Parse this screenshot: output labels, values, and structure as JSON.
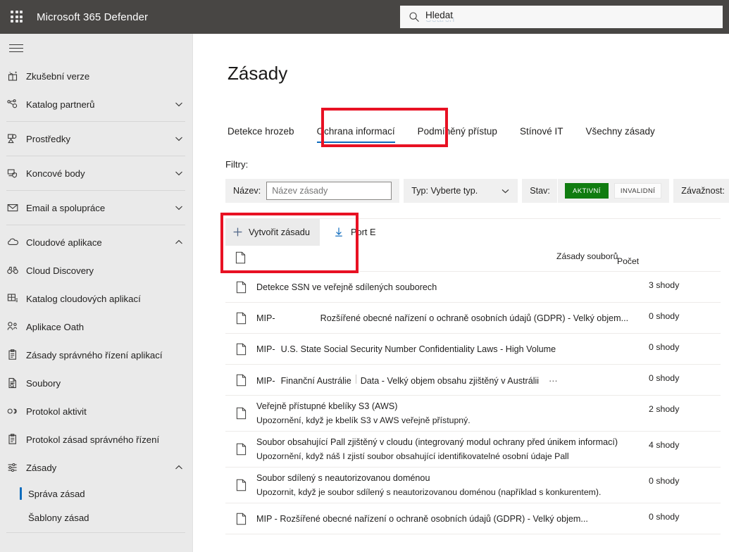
{
  "suite": {
    "waffle_icon": "app-launcher-waffle-icon",
    "title": "Microsoft 365 Defender",
    "search": {
      "icon": "search-icon",
      "placeholder": "Hledat",
      "ghost_text": "Search"
    }
  },
  "nav": {
    "hamburger_label": "global-nav-toggle",
    "groups": [
      {
        "items": [
          {
            "label": "Zkušební verze",
            "icon": "gift-sparkle-icon",
            "expandable": false
          },
          {
            "label": "Katalog partnerů",
            "icon": "partner-network-icon",
            "expandable": true,
            "expanded": false
          }
        ]
      },
      {
        "items": [
          {
            "label": "Prostředky",
            "icon": "assets-shapes-icon",
            "expandable": true,
            "expanded": false
          }
        ]
      },
      {
        "items": [
          {
            "label": "Koncové body",
            "icon": "endpoint-shield-icon",
            "expandable": true,
            "expanded": false
          }
        ]
      },
      {
        "items": [
          {
            "label": "Email a spolupráce",
            "icon": "mail-envelope-icon",
            "expandable": true,
            "expanded": false
          }
        ]
      },
      {
        "items": [
          {
            "label": "Cloudové aplikace",
            "icon": "cloud-icon",
            "expandable": true,
            "expanded": true
          },
          {
            "label": "Cloud Discovery",
            "icon": "binoculars-icon",
            "expandable": false
          },
          {
            "label": "Katalog cloudových aplikací",
            "icon": "app-catalog-grid-icon",
            "expandable": false
          },
          {
            "label": "Aplikace Oath",
            "icon": "oauth-apps-icon",
            "expandable": false
          },
          {
            "label": "Zásady správného řízení aplikací",
            "icon": "clipboard-governance-icon",
            "expandable": false
          },
          {
            "label": "Soubory",
            "icon": "file-search-icon",
            "expandable": false
          },
          {
            "label": "Protokol aktivit",
            "icon": "activity-log-icon",
            "expandable": false
          },
          {
            "label": "Protokol zásad správného řízení",
            "icon": "clipboard-log-icon",
            "expandable": false
          },
          {
            "label": "Zásady",
            "icon": "policy-sliders-icon",
            "expandable": true,
            "expanded": true
          }
        ],
        "subitems": [
          {
            "label": "Správa zásad",
            "selected": true
          },
          {
            "label": "Šablony zásad",
            "selected": false
          }
        ]
      }
    ]
  },
  "main": {
    "page_title": "Zásady",
    "tabs": [
      {
        "label": "Detekce hrozeb",
        "selected": false
      },
      {
        "label": "Ochrana informací",
        "selected": true,
        "annotated": true
      },
      {
        "label": "Podmíněný přístup",
        "selected": false
      },
      {
        "label": "Stínové IT",
        "selected": false
      },
      {
        "label": "Všechny zásady",
        "selected": false
      }
    ],
    "filters": {
      "label": "Filtry:",
      "name": {
        "label": "Název:",
        "value": "",
        "placeholder": "Název zásady"
      },
      "type": {
        "label": "Typ: Vyberte typ.",
        "chevron_icon": "chevron-down-icon"
      },
      "state": {
        "label": "Stav:",
        "active_label": "AKTIVNÍ",
        "invalid_label": "INVALIDNÍ",
        "active_selected": true
      },
      "severity": {
        "label": "Závažnost:",
        "swatches": [
          "#f7630c",
          "#bdbdbd"
        ]
      }
    },
    "toolbar": {
      "create_label": "Vytvořit zásadu",
      "create_icon": "plus-icon",
      "export_label": "Port E",
      "export_icon": "download-arrow-icon",
      "annotated": true
    },
    "table": {
      "columns": {
        "icon": "file-icon",
        "policy": "Zásady souborů",
        "count": "Počet"
      },
      "rows": [
        {
          "icon": "file-icon",
          "prefix": "",
          "mid": "",
          "title": "Detekce SSN ve veřejně sdílených souborech",
          "desc": "",
          "count": "3 shody",
          "has_overflow": false,
          "layout": "title-only"
        },
        {
          "icon": "file-icon",
          "prefix": "MIP-",
          "mid": "",
          "title": "Rozšířené obecné nařízení o ochraně osobních údajů (GDPR) - Velký objem...",
          "desc": "",
          "count": "0 shody",
          "has_overflow": false,
          "layout": "prefix-wide-gap"
        },
        {
          "icon": "file-icon",
          "prefix": "MIP-",
          "mid": "",
          "title": "U.S. State Social Security Number Confidentiality Laws - High Volume",
          "desc": "",
          "count": "0 shody",
          "has_overflow": false,
          "layout": "prefix-small-gap"
        },
        {
          "icon": "file-icon",
          "prefix": "MIP-",
          "mid": "Finanční Austrálie",
          "title": "Data - Velký objem obsahu zjištěný v Austrálii",
          "desc": "",
          "count": "0 shody",
          "has_overflow": true,
          "overflow_icon": "more-ellipsis-icon",
          "layout": "prefix-mid-sep"
        },
        {
          "icon": "file-icon",
          "prefix": "",
          "mid": "",
          "title": "Veřejně přístupné kbelíky S3 (AWS)",
          "desc": "Upozornění, když je kbelík S3 v AWS veřejně přístupný.",
          "count": "2 shody",
          "has_overflow": false,
          "layout": "title-desc"
        },
        {
          "icon": "file-icon",
          "prefix": "",
          "mid": "",
          "title": "Soubor obsahující Pall zjištěný v cloudu (integrovaný modul ochrany před únikem informací)",
          "desc": "Upozornění, když náš I zjistí soubor obsahující identifikovatelné osobní údaje Pall",
          "count": "4 shody",
          "has_overflow": false,
          "layout": "title-desc"
        },
        {
          "icon": "file-icon",
          "prefix": "",
          "mid": "",
          "title": "Soubor sdílený s neautorizovanou doménou",
          "desc": "Upozornit, když je soubor sdílený s neautorizovanou doménou (například s konkurentem).",
          "count": "0 shody",
          "has_overflow": false,
          "layout": "title-desc"
        },
        {
          "icon": "file-icon",
          "prefix": "",
          "mid": "",
          "title": "MIP - Rozšířené obecné nařízení o ochraně osobních údajů (GDPR) - Velký objem...",
          "desc": "",
          "count": "0 shody",
          "has_overflow": false,
          "layout": "title-only"
        }
      ]
    }
  },
  "colors": {
    "suitebar": "#484644",
    "nav_bg": "#eaeaea",
    "accent": "#0f6cbd",
    "annotation": "#e81123",
    "active_green": "#107c10",
    "severity_orange": "#f7630c"
  }
}
